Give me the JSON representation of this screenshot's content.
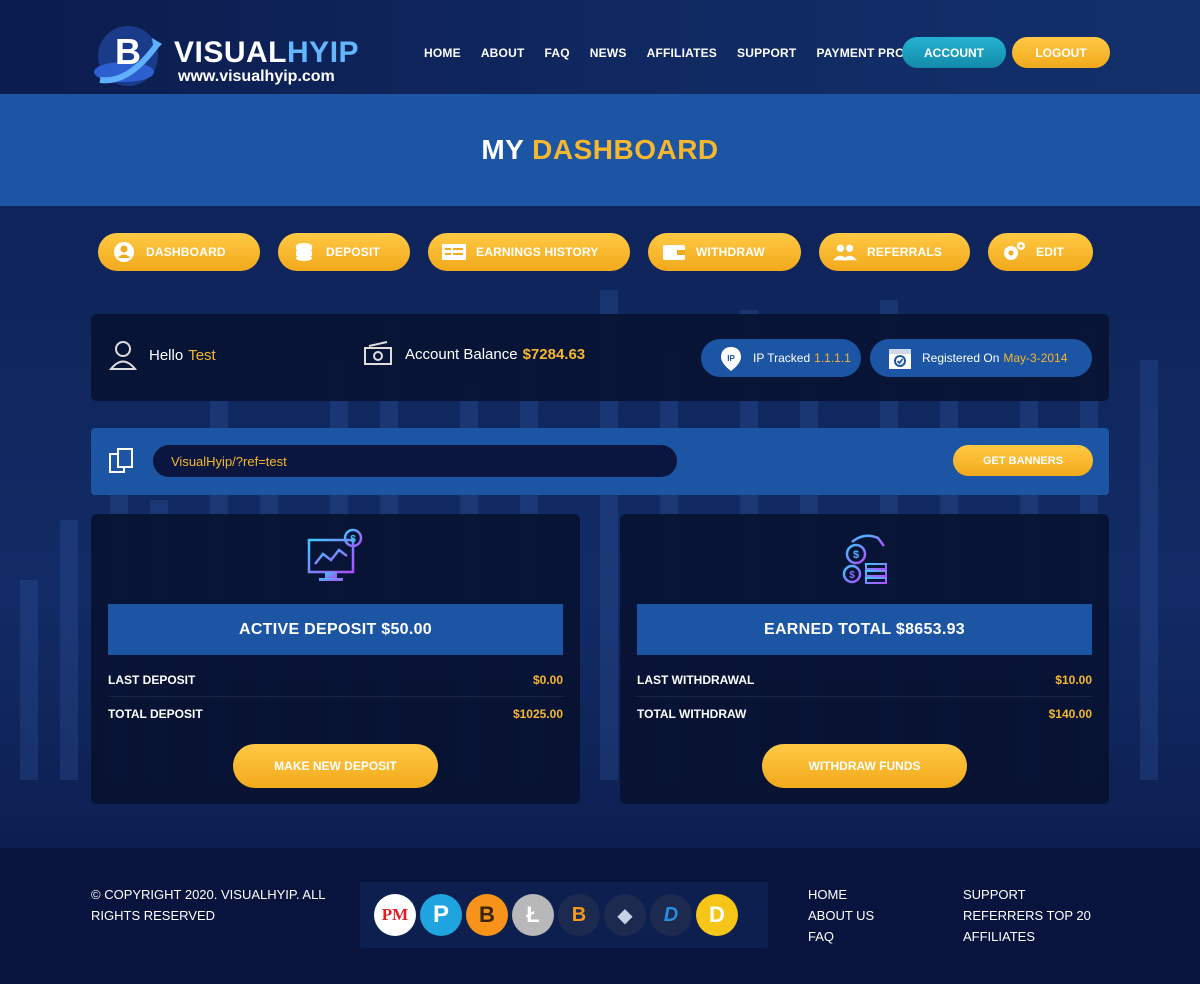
{
  "brand": {
    "name_part1": "VISUAL",
    "name_part2": "HYIP",
    "url": "www.visualhyip.com",
    "colors": {
      "accent_gold": "#f5b630",
      "panel_blue": "#1b55a3",
      "dark_navy": "#08143d",
      "account_teal": "#1ca0c0"
    }
  },
  "nav": {
    "items": [
      {
        "label": "HOME"
      },
      {
        "label": "ABOUT"
      },
      {
        "label": "FAQ"
      },
      {
        "label": "NEWS"
      },
      {
        "label": "AFFILIATES"
      },
      {
        "label": "SUPPORT"
      },
      {
        "label": "PAYMENT PROOF"
      }
    ],
    "account_label": "ACCOUNT",
    "logout_label": "LOGOUT"
  },
  "page_title": {
    "part1": "MY",
    "part2": "DASHBOARD"
  },
  "tabs": [
    {
      "label": "DASHBOARD",
      "icon": "user-circle-icon"
    },
    {
      "label": "DEPOSIT",
      "icon": "coins-icon"
    },
    {
      "label": "EARNINGS HISTORY",
      "icon": "history-icon"
    },
    {
      "label": "WITHDRAW",
      "icon": "wallet-icon"
    },
    {
      "label": "REFERRALS",
      "icon": "users-icon"
    },
    {
      "label": "EDIT",
      "icon": "gears-icon"
    }
  ],
  "info": {
    "hello_label": "Hello",
    "username": "Test",
    "balance_label": "Account Balance",
    "balance_value": "$7284.63",
    "ip_label": "IP Tracked",
    "ip_value": "1.1.1.1",
    "registered_label": "Registered On",
    "registered_value": "May-3-2014"
  },
  "referral": {
    "link": "VisualHyip/?ref=test",
    "banners_label": "GET BANNERS"
  },
  "deposit_card": {
    "headline": "ACTIVE DEPOSIT $50.00",
    "rows": [
      {
        "label": "LAST DEPOSIT",
        "value": "$0.00"
      },
      {
        "label": "TOTAL DEPOSIT",
        "value": "$1025.00"
      }
    ],
    "button_label": "MAKE NEW DEPOSIT"
  },
  "earned_card": {
    "headline": "EARNED TOTAL $8653.93",
    "rows": [
      {
        "label": "LAST WITHDRAWAL",
        "value": "$10.00"
      },
      {
        "label": "TOTAL WITHDRAW",
        "value": "$140.00"
      }
    ],
    "button_label": "WITHDRAW FUNDS"
  },
  "footer": {
    "copyright": "© COPYRIGHT 2020. VISUALHYIP. ALL RIGHTS RESERVED",
    "payments": [
      {
        "label": "PM",
        "icon": "perfect-money-icon",
        "color": "#e31c23"
      },
      {
        "label": "P",
        "icon": "payeer-icon",
        "color": "#1fa4e0"
      },
      {
        "label": "B",
        "icon": "bitcoin-icon",
        "color": "#f7931a"
      },
      {
        "label": "Ł",
        "icon": "litecoin-icon",
        "color": "#b8b8b8"
      },
      {
        "label": "B",
        "icon": "bitcoin-cash-icon",
        "color": "#f39a1d"
      },
      {
        "label": "◆",
        "icon": "ethereum-icon",
        "color": "#1c2a4f"
      },
      {
        "label": "D",
        "icon": "dash-icon",
        "color": "#1c2a4f"
      },
      {
        "label": "D",
        "icon": "dogecoin-icon",
        "color": "#f5c518"
      }
    ],
    "links_col1": [
      {
        "label": "HOME"
      },
      {
        "label": "ABOUT US"
      },
      {
        "label": "FAQ"
      }
    ],
    "links_col2": [
      {
        "label": "SUPPORT"
      },
      {
        "label": "REFERRERS TOP 20"
      },
      {
        "label": "AFFILIATES"
      }
    ]
  }
}
